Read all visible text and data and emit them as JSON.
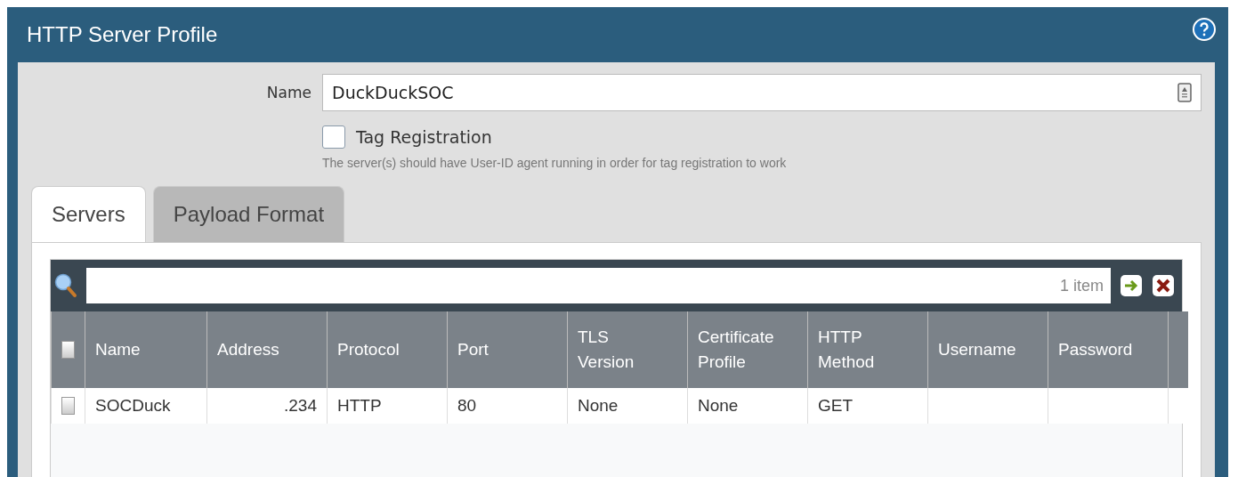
{
  "window": {
    "title": "HTTP Server Profile"
  },
  "name_field": {
    "label": "Name",
    "value": "DuckDuckSOC"
  },
  "tag_registration": {
    "label": "Tag Registration",
    "checked": false,
    "hint": "The server(s) should have User-ID agent running in order for tag registration to work"
  },
  "tabs": [
    {
      "label": "Servers",
      "selected": true
    },
    {
      "label": "Payload Format",
      "selected": false
    }
  ],
  "grid": {
    "count": "1 item",
    "select_all": false,
    "columns": [
      "Name",
      "Address",
      "Protocol",
      "Port",
      "TLS\nVersion",
      "Certificate\nProfile",
      "HTTP\nMethod",
      "Username",
      "Password"
    ],
    "rows": [
      {
        "selected": false,
        "cells": [
          "SOCDuck",
          ".234",
          "HTTP",
          "80",
          "None",
          "None",
          "GET",
          "",
          ""
        ]
      }
    ]
  }
}
